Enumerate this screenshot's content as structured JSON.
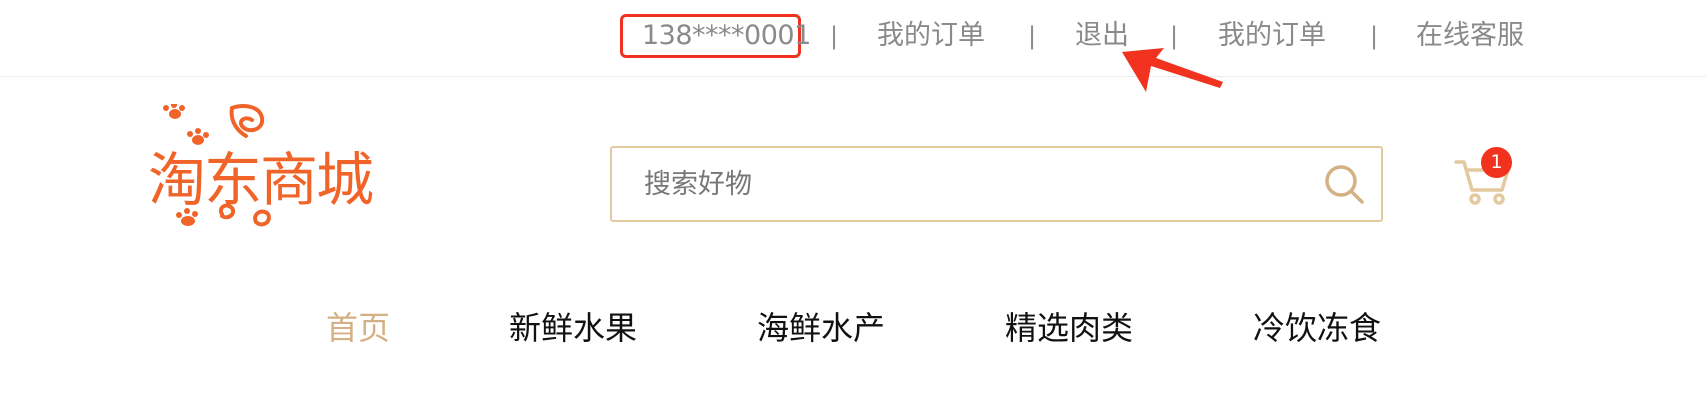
{
  "topbar": {
    "phone": "138****0001",
    "orders_label": "我的订单",
    "logout_label": "退出",
    "orders2_label": "我的订单",
    "service_label": "在线客服",
    "separator": "|"
  },
  "header": {
    "logo_text": "淘东商城",
    "search_placeholder": "搜索好物",
    "cart_count": "1"
  },
  "nav": {
    "items": [
      "首页",
      "新鲜水果",
      "海鲜水产",
      "精选肉类",
      "冷饮冻食"
    ],
    "active_index": 0
  },
  "colors": {
    "brand_orange": "#f0642a",
    "highlight_red": "#f0321e",
    "gold_accent": "#d4b184",
    "search_border": "#e3c99e"
  },
  "icons": {
    "search": "search-icon",
    "cart": "cart-icon",
    "annotation": "arrow-annotation-icon"
  }
}
